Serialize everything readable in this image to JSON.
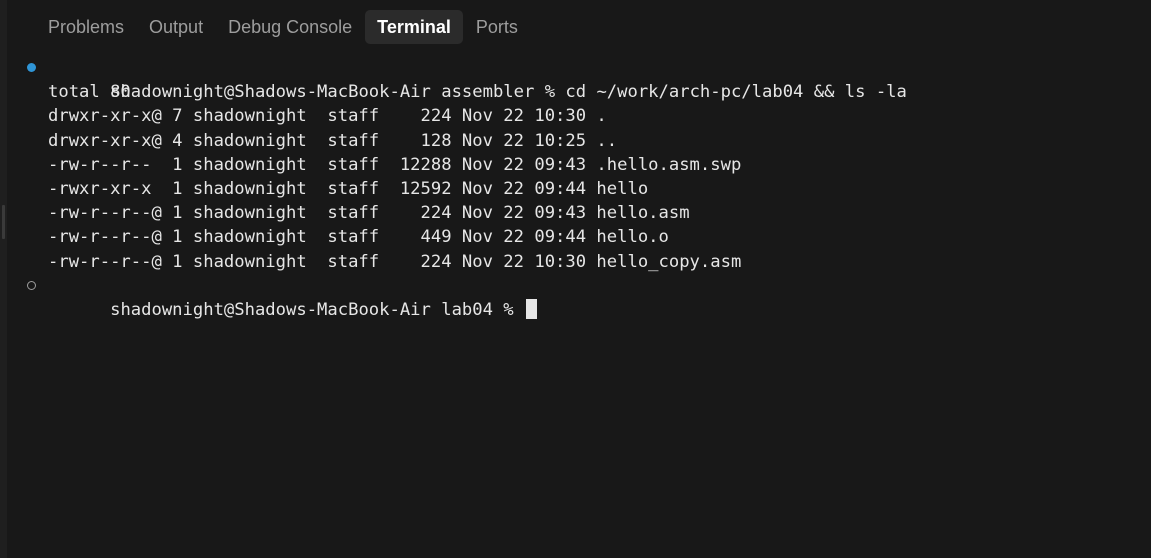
{
  "tabs": [
    {
      "label": "Problems",
      "active": false
    },
    {
      "label": "Output",
      "active": false
    },
    {
      "label": "Debug Console",
      "active": false
    },
    {
      "label": "Terminal",
      "active": true
    },
    {
      "label": "Ports",
      "active": false
    }
  ],
  "terminal": {
    "lines": [
      "shadownight@Shadows-MacBook-Air assembler % cd ~/work/arch-pc/lab04 && ls -la",
      "total 80",
      "drwxr-xr-x@ 7 shadownight  staff    224 Nov 22 10:30 .",
      "drwxr-xr-x@ 4 shadownight  staff    128 Nov 22 10:25 ..",
      "-rw-r--r--  1 shadownight  staff  12288 Nov 22 09:43 .hello.asm.swp",
      "-rwxr-xr-x  1 shadownight  staff  12592 Nov 22 09:44 hello",
      "-rw-r--r--@ 1 shadownight  staff    224 Nov 22 09:43 hello.asm",
      "-rw-r--r--@ 1 shadownight  staff    449 Nov 22 09:44 hello.o",
      "-rw-r--r--@ 1 shadownight  staff    224 Nov 22 10:30 hello_copy.asm",
      "shadownight@Shadows-MacBook-Air lab04 % "
    ]
  },
  "colors": {
    "background": "#181818",
    "active_tab_bg": "#2b2b2b",
    "command_decoration_success": "#2f95d6",
    "inactive_tab_text": "#9d9d9d",
    "terminal_text": "#e6e6e6"
  }
}
